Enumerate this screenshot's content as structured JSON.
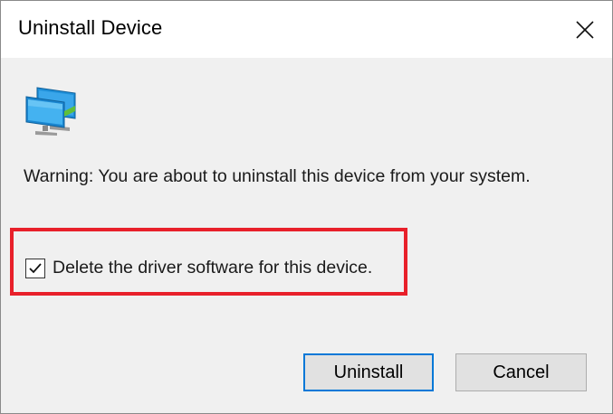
{
  "dialog": {
    "title": "Uninstall Device",
    "close_icon": "close-icon",
    "device_icon": "network-adapter-icon",
    "warning_text": "Warning: You are about to uninstall this device from your system.",
    "checkbox": {
      "label": "Delete the driver software for this device.",
      "checked": true
    },
    "buttons": {
      "uninstall": "Uninstall",
      "cancel": "Cancel"
    }
  },
  "colors": {
    "highlight": "#e8202a",
    "default_button_border": "#0078d7",
    "dialog_bg": "#f0f0f0",
    "titlebar_bg": "#ffffff"
  }
}
